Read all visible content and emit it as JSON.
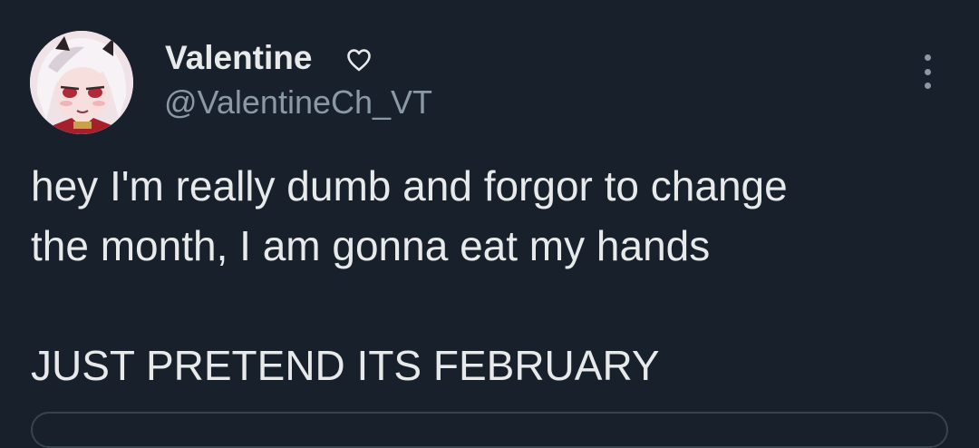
{
  "user": {
    "display_name": "Valentine",
    "handle": "@ValentineCh_VT",
    "verified_heart_icon": "heart-outline-icon",
    "avatar_icon": "avatar-image"
  },
  "tweet": {
    "line1": "hey I'm really dumb and forgor to change",
    "line2": "the month, I am gonna eat my hands",
    "line3": "JUST PRETEND ITS FEBRUARY"
  },
  "actions": {
    "more_icon": "more-vertical-icon"
  },
  "colors": {
    "background": "#17202b",
    "text_primary": "#e7e9ea",
    "text_secondary": "#8b98a5",
    "border": "#38444d"
  }
}
